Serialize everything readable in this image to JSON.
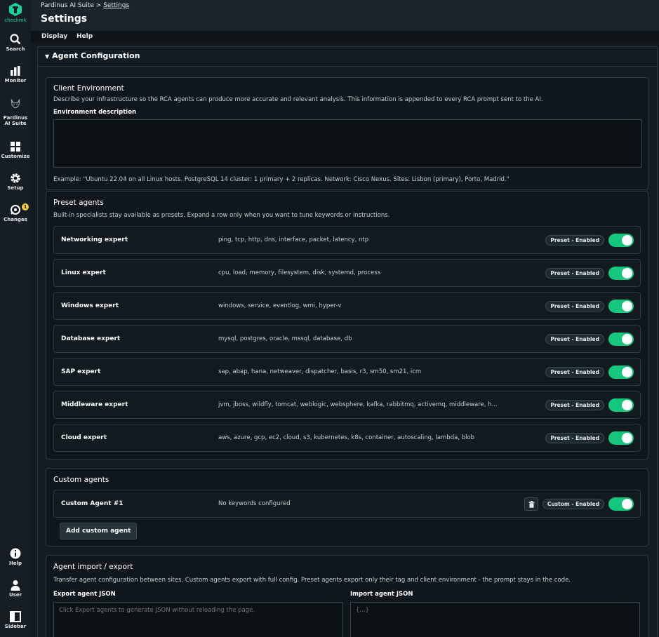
{
  "sidebar": {
    "logo_text": "checkmk",
    "items": [
      {
        "label": "Search",
        "icon": "search-icon"
      },
      {
        "label": "Monitor",
        "icon": "bar-chart-icon"
      },
      {
        "label": "Pardinus AI Suite",
        "label_line1": "Pardinus",
        "label_line2": "AI Suite",
        "icon": "lynx-icon"
      },
      {
        "label": "Customize",
        "icon": "grid-icon"
      },
      {
        "label": "Setup",
        "icon": "gear-icon"
      },
      {
        "label": "Changes",
        "icon": "changes-icon",
        "badge": "1"
      }
    ],
    "bottom_items": [
      {
        "label": "Help",
        "icon": "info-icon"
      },
      {
        "label": "User",
        "icon": "user-icon"
      },
      {
        "label": "Sidebar",
        "icon": "sidebar-icon"
      }
    ]
  },
  "header": {
    "breadcrumb_root": "Pardinus AI Suite",
    "breadcrumb_sep": ">",
    "breadcrumb_current": "Settings",
    "title": "Settings"
  },
  "menu": [
    "Display",
    "Help"
  ],
  "section": {
    "title": "Agent Configuration"
  },
  "client_env": {
    "title": "Client Environment",
    "description": "Describe your infrastructure so the RCA agents can produce more accurate and relevant analysis. This information is appended to every RCA prompt sent to the AI.",
    "field_label": "Environment description",
    "value": "",
    "example": "Example: \"Ubuntu 22.04 on all Linux hosts. PostgreSQL 14 cluster: 1 primary + 2 replicas. Network: Cisco Nexus. Sites: Lisbon (primary), Porto, Madrid.\""
  },
  "preset_agents": {
    "title": "Preset agents",
    "description": "Built-in specialists stay available as presets. Expand a row only when you want to tune keywords or instructions.",
    "items": [
      {
        "name": "Networking expert",
        "keywords": "ping, tcp, http, dns, interface, packet, latency, ntp",
        "tag": "Preset - Enabled",
        "enabled": true
      },
      {
        "name": "Linux expert",
        "keywords": "cpu, load, memory, filesystem, disk, systemd, process",
        "tag": "Preset - Enabled",
        "enabled": true
      },
      {
        "name": "Windows expert",
        "keywords": "windows, service, eventlog, wmi, hyper-v",
        "tag": "Preset - Enabled",
        "enabled": true
      },
      {
        "name": "Database expert",
        "keywords": "mysql, postgres, oracle, mssql, database, db",
        "tag": "Preset - Enabled",
        "enabled": true
      },
      {
        "name": "SAP expert",
        "keywords": "sap, abap, hana, netweaver, dispatcher, basis, r3, sm50, sm21, icm",
        "tag": "Preset - Enabled",
        "enabled": true
      },
      {
        "name": "Middleware expert",
        "keywords": "jvm, jboss, wildfly, tomcat, weblogic, websphere, kafka, rabbitmq, activemq, middleware, h...",
        "tag": "Preset - Enabled",
        "enabled": true
      },
      {
        "name": "Cloud expert",
        "keywords": "aws, azure, gcp, ec2, cloud, s3, kubernetes, k8s, container, autoscaling, lambda, blob",
        "tag": "Preset - Enabled",
        "enabled": true
      }
    ]
  },
  "custom_agents": {
    "title": "Custom agents",
    "items": [
      {
        "name": "Custom Agent #1",
        "keywords": "No keywords configured",
        "tag": "Custom - Enabled",
        "enabled": true
      }
    ],
    "add_label": "Add custom agent"
  },
  "import_export": {
    "title": "Agent import / export",
    "description": "Transfer agent configuration between sites. Custom agents export with full config. Preset agents export only their tag and client environment - the prompt stays in the code.",
    "export_label": "Export agent JSON",
    "export_placeholder": "Click Export agents to generate JSON without reloading the page.",
    "import_label": "Import agent JSON",
    "import_placeholder": "{...}"
  },
  "colors": {
    "accent": "#15d1a0",
    "toggle_on": "#15c77d",
    "badge": "#ffcf29"
  }
}
